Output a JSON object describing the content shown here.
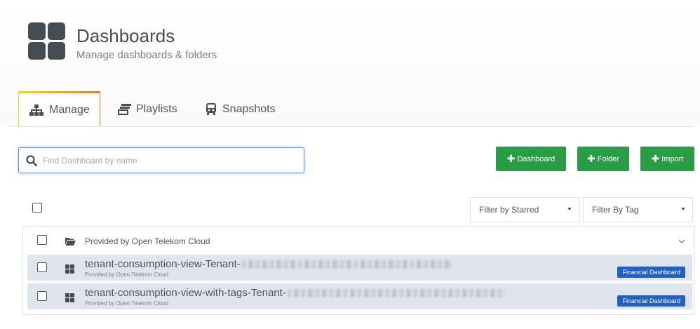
{
  "header": {
    "title": "Dashboards",
    "subtitle": "Manage dashboards & folders",
    "icon": "dashboards-grid-icon"
  },
  "tabs": [
    {
      "label": "Manage",
      "icon": "sitemap-icon",
      "active": true
    },
    {
      "label": "Playlists",
      "icon": "playlist-icon",
      "active": false
    },
    {
      "label": "Snapshots",
      "icon": "snapshot-camera-icon",
      "active": false
    }
  ],
  "search": {
    "placeholder": "Find Dashboard by name",
    "value": ""
  },
  "actions": {
    "dashboard_label": "Dashboard",
    "folder_label": "Folder",
    "import_label": "Import"
  },
  "filters": {
    "starred_label": "Filter by Starred",
    "tag_label": "Filter By Tag"
  },
  "folder": {
    "name": "Provided by Open Telekom Cloud"
  },
  "dashboards": [
    {
      "title": "tenant-consumption-view-Tenant-",
      "folder": "Provided by Open Telekom Cloud",
      "tag": "Financial Dashboard"
    },
    {
      "title": "tenant-consumption-view-with-tags-Tenant-",
      "folder": "Provided by Open Telekom Cloud",
      "tag": "Financial Dashboard"
    }
  ],
  "colors": {
    "accent_green": "#299c46",
    "tag_blue": "#1f60c4",
    "focus_blue": "#5794f2",
    "row_bg": "#dfe5ec"
  }
}
